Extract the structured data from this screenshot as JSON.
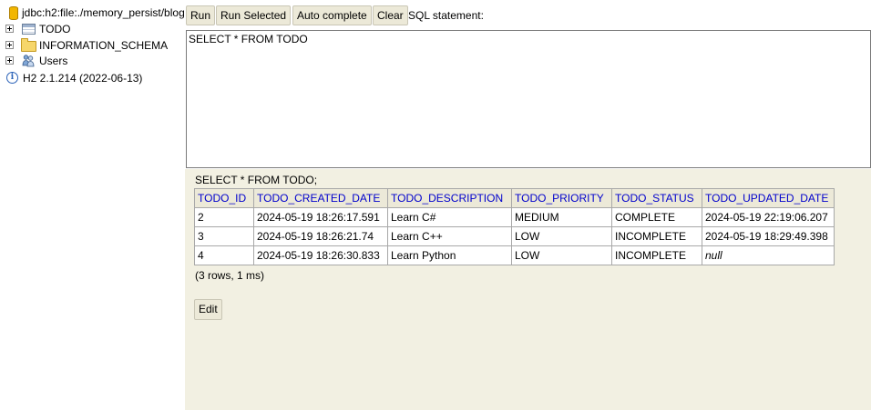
{
  "tree": {
    "connection": "jdbc:h2:file:./memory_persist/blog",
    "items": [
      {
        "label": "TODO",
        "icon": "table-icon"
      },
      {
        "label": "INFORMATION_SCHEMA",
        "icon": "folder-icon"
      },
      {
        "label": "Users",
        "icon": "users-icon"
      }
    ],
    "version": "H2 2.1.214 (2022-06-13)"
  },
  "toolbar": {
    "run": "Run",
    "run_selected": "Run Selected",
    "auto_complete": "Auto complete",
    "clear": "Clear",
    "sql_label": "SQL statement:"
  },
  "editor": {
    "value": "SELECT * FROM TODO"
  },
  "result": {
    "statement": "SELECT * FROM TODO;",
    "columns": [
      "TODO_ID",
      "TODO_CREATED_DATE",
      "TODO_DESCRIPTION",
      "TODO_PRIORITY",
      "TODO_STATUS",
      "TODO_UPDATED_DATE"
    ],
    "rows": [
      [
        "2",
        "2024-05-19 18:26:17.591",
        "Learn C#",
        "MEDIUM",
        "COMPLETE",
        "2024-05-19 22:19:06.207"
      ],
      [
        "3",
        "2024-05-19 18:26:21.74",
        "Learn C++",
        "LOW",
        "INCOMPLETE",
        "2024-05-19 18:29:49.398"
      ],
      [
        "4",
        "2024-05-19 18:26:30.833",
        "Learn Python",
        "LOW",
        "INCOMPLETE",
        "null"
      ]
    ],
    "row_count": "(3 rows, 1 ms)",
    "edit_label": "Edit"
  },
  "colors": {
    "header_text": "#0000cc",
    "button_bg": "#ece9d8",
    "result_bg": "#f2f0e2"
  }
}
